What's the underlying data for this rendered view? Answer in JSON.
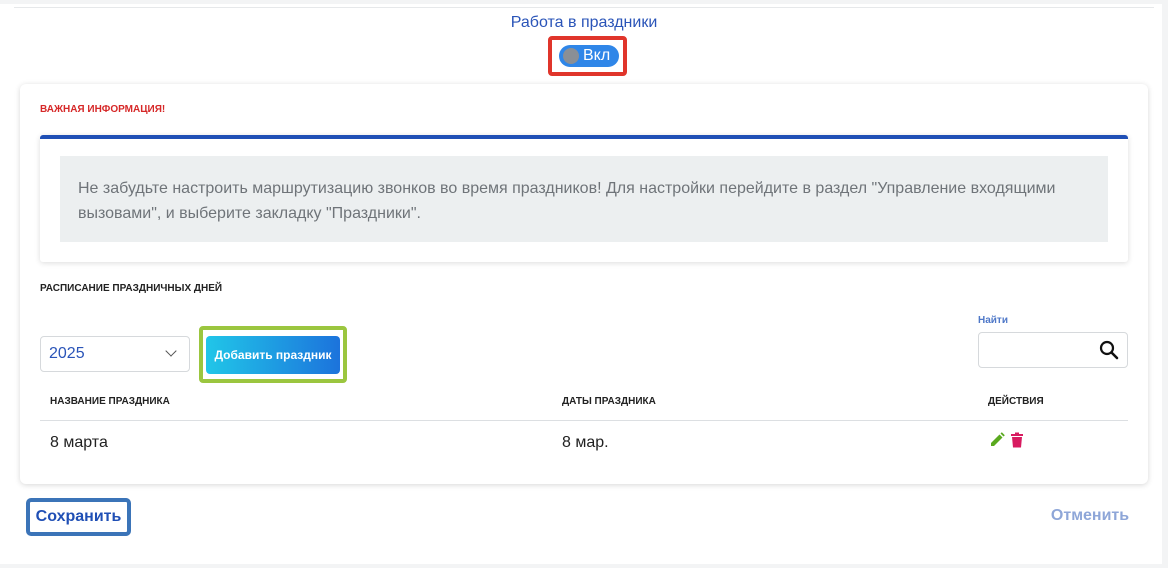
{
  "holiday_work": {
    "title": "Работа в праздники",
    "toggle_label": "Вкл",
    "toggle_on": true
  },
  "info": {
    "heading": "ВАЖНАЯ ИНФОРМАЦИЯ!",
    "message": "Не забудьте настроить маршрутизацию звонков во время праздников! Для настройки перейдите в раздел \"Управление входящими вызовами\", и выберите закладку \"Праздники\"."
  },
  "schedule": {
    "heading": "РАСПИСАНИЕ ПРАЗДНИЧНЫХ ДНЕЙ",
    "year": "2025",
    "add_button": "Добавить праздник",
    "search_label": "Найти",
    "search_value": "",
    "columns": {
      "name": "НАЗВАНИЕ ПРАЗДНИКА",
      "dates": "ДАТЫ ПРАЗДНИКА",
      "actions": "ДЕЙСТВИЯ"
    },
    "rows": [
      {
        "name": "8 марта",
        "dates": "8 мар."
      }
    ]
  },
  "footer": {
    "save": "Сохранить",
    "cancel": "Отменить"
  },
  "colors": {
    "accent_blue": "#2a54b8",
    "toggle_on": "#2f86e8",
    "alert_red": "#d62828",
    "edit_green": "#5aa91f",
    "delete_red": "#d81b60"
  }
}
